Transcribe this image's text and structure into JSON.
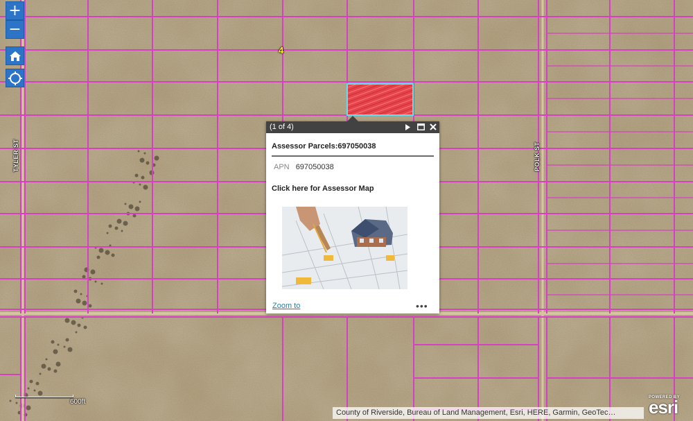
{
  "map": {
    "zoom_in_label": "+",
    "zoom_out_label": "−",
    "section_number": "4",
    "streets": [
      "TYLER ST",
      "POLK ST"
    ],
    "colors": {
      "desert": "#b3a17f",
      "parcel_lines": "#d73fc4",
      "road": "#d6c5a0",
      "selection_fill": "#e8434a",
      "selection_outline": "#5fe0f0",
      "button": "#2b74c7"
    }
  },
  "popup": {
    "count": "(1 of 4)",
    "title": "Assessor Parcels:697050038",
    "attribute_key": "APN",
    "attribute_value": "697050038",
    "link_text": "Click here for Assessor Map",
    "zoom_to": "Zoom to",
    "more": "•••"
  },
  "scalebar": {
    "label": "600ft"
  },
  "attribution": "County of Riverside, Bureau of Land Management, Esri, HERE, Garmin, GeoTec…",
  "esri": {
    "powered": "POWERED BY",
    "word": "esri"
  }
}
